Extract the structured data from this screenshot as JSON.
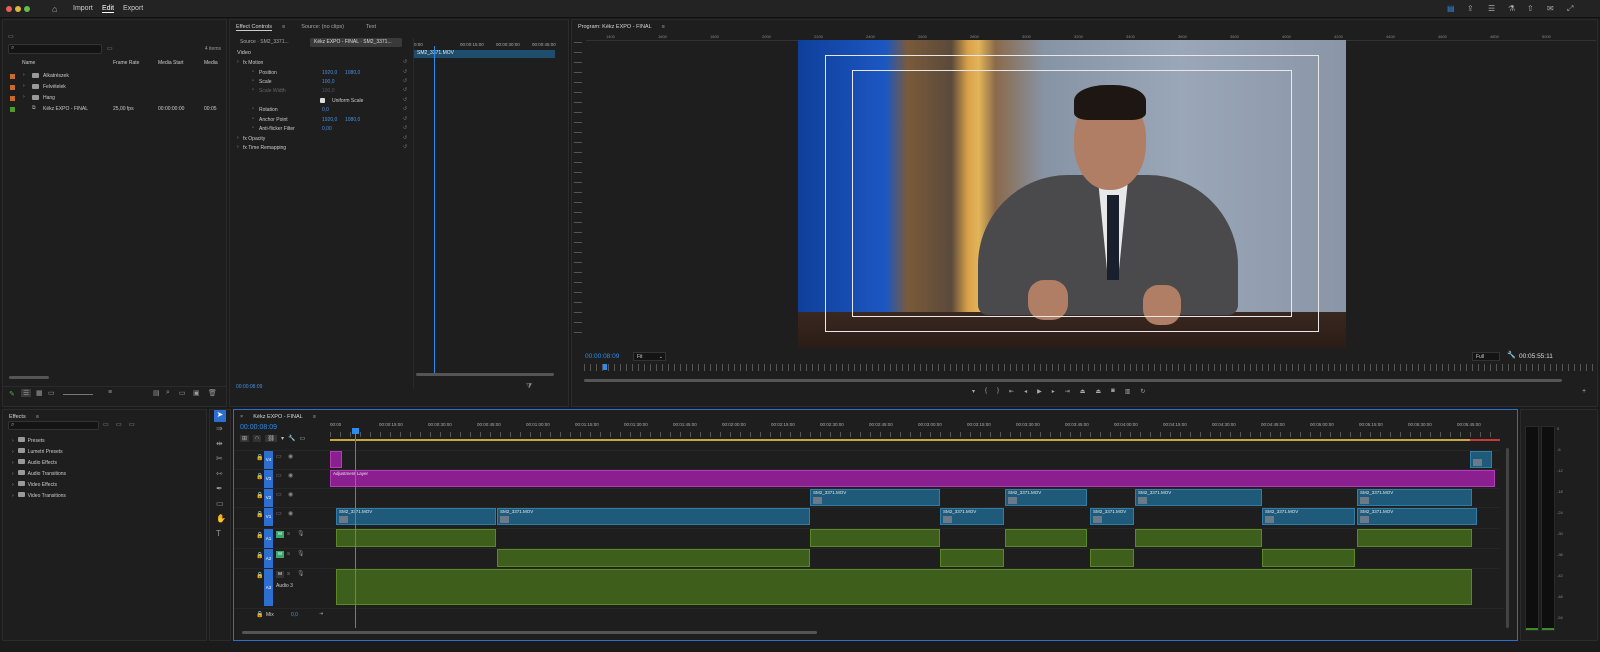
{
  "menu": {
    "home": "home-icon",
    "items": [
      "Import",
      "Edit",
      "Export"
    ],
    "active": "Edit"
  },
  "project": {
    "search_placeholder": "",
    "item_count": "4 items",
    "columns": [
      "Name",
      "Frame Rate",
      "Media Start",
      "Media"
    ],
    "items": [
      {
        "name": "Alkatrészek",
        "color": "#c9692b",
        "fps": "",
        "start": "",
        "media": ""
      },
      {
        "name": "Felvételek",
        "color": "#c9692b",
        "fps": "",
        "start": "",
        "media": ""
      },
      {
        "name": "Hang",
        "color": "#c9692b",
        "fps": "",
        "start": "",
        "media": ""
      },
      {
        "name": "Kékz EXPO - FINAL",
        "color": "#4e9a2b",
        "fps": "25,00 fps",
        "start": "00:00:00:00",
        "media": "00:05"
      }
    ]
  },
  "effect_controls": {
    "tabs": [
      "Effect Controls",
      "Source: (no clips)",
      "Text"
    ],
    "source_tab": "Source · SM2_3371...",
    "seq_tab": "Kékz EXPO - FINAL · SM2_3371...",
    "ruler": [
      "0:00",
      "00:00:15:00",
      "00:00:30:00",
      "00:00:45:00"
    ],
    "clip_name": "SM2_3371.MOV",
    "section": "Video",
    "rows": [
      {
        "label": "fx Motion",
        "v1": "",
        "v2": ""
      },
      {
        "label": "Position",
        "v1": "1920,0",
        "v2": "1080,0"
      },
      {
        "label": "Scale",
        "v1": "100,0",
        "v2": ""
      },
      {
        "label": "Scale Width",
        "v1": "100,0",
        "v2": ""
      },
      {
        "label": "Uniform Scale",
        "v1": "",
        "v2": ""
      },
      {
        "label": "Rotation",
        "v1": "0,0",
        "v2": ""
      },
      {
        "label": "Anchor Point",
        "v1": "1920,0",
        "v2": "1080,0"
      },
      {
        "label": "Anti-flicker Filter",
        "v1": "0,00",
        "v2": ""
      },
      {
        "label": "fx Opacity",
        "v1": "",
        "v2": ""
      },
      {
        "label": "fx Time Remapping",
        "v1": "",
        "v2": ""
      }
    ],
    "timecode": "00:00:08:09"
  },
  "program": {
    "title": "Program: Kékz EXPO - FINAL",
    "ruler": [
      "1400",
      "1600",
      "1800",
      "2000",
      "2200",
      "2400",
      "2600",
      "2800",
      "3000",
      "3200",
      "3400",
      "3600",
      "3800",
      "4000",
      "4200",
      "4400",
      "4600",
      "4800",
      "5000"
    ],
    "timecode": "00:00:08:09",
    "fit": "Fit",
    "quality": "Full",
    "duration": "00:05:55:11"
  },
  "effects": {
    "title": "Effects",
    "items": [
      "Presets",
      "Lumetri Presets",
      "Audio Effects",
      "Audio Transitions",
      "Video Effects",
      "Video Transitions"
    ]
  },
  "timeline": {
    "tab": "Kékz EXPO - FINAL",
    "timecode": "00:00:08:09",
    "ruler": [
      "00:00",
      "00:00:15:00",
      "00:00:30:00",
      "00:00:45:00",
      "00:01:00:00",
      "00:01:15:00",
      "00:01:30:00",
      "00:01:45:00",
      "00:02:00:00",
      "00:02:15:00",
      "00:02:30:00",
      "00:02:45:00",
      "00:03:00:00",
      "00:03:15:00",
      "00:03:30:00",
      "00:03:45:00",
      "00:04:00:00",
      "00:04:15:00",
      "00:04:30:00",
      "00:04:45:00",
      "00:05:00:00",
      "00:05:15:00",
      "00:05:30:00",
      "00:05:45:00"
    ],
    "tracks": [
      "V4",
      "V3",
      "V2",
      "V1",
      "A1",
      "A2",
      "A3"
    ],
    "adjustment_label": "Adjustment Layer",
    "clip_label": "SM2_3371.MOV",
    "audio3": "Audio 3",
    "mix": "Mix",
    "mix_value": "0,0",
    "meter_scale": [
      "0",
      "-6",
      "-12",
      "-18",
      "-24",
      "-30",
      "-36",
      "-42",
      "-48",
      "-54"
    ]
  },
  "colors": {
    "accent": "#2d8ceb",
    "video_clip": "#1f5a7a",
    "audio_clip": "#3e5e1c",
    "adjustment": "#8b1f8f"
  }
}
